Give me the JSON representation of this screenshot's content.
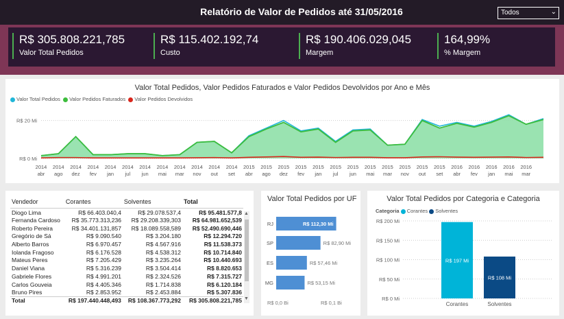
{
  "header": {
    "title": "Relatório de Valor de Pedidos até 31/05/2016",
    "filter_value": "Todos"
  },
  "kpis": [
    {
      "value": "R$ 305.808.221,785",
      "label": "Valor Total Pedidos"
    },
    {
      "value": "R$ 115.402.192,74",
      "label": "Custo"
    },
    {
      "value": "R$ 190.406.029,045",
      "label": "Margem"
    },
    {
      "value": "164,99%",
      "label": "% Margem"
    }
  ],
  "colors": {
    "header_bg": "#231b27",
    "kpi_band": "#7e3656",
    "kpi_panel": "#2b1832",
    "kpi_accent": "#4caf50",
    "total_pedidos": "#20b6d8",
    "faturados": "#3dbd3d",
    "devolvidos": "#d9261c",
    "uf_bar": "#4e8fd4",
    "corantes": "#00b4d8",
    "solventes": "#0b4a85"
  },
  "chart_data": [
    {
      "type": "area",
      "title": "Valor Total Pedidos, Valor Pedidos Faturados e Valor Pedidos Devolvidos por Ano e Mês",
      "y_ticks": [
        "R$ 20 Mi",
        "R$ 0 Mi"
      ],
      "ylim": [
        0,
        26
      ],
      "grid": true,
      "legend_position": "top-left",
      "categories": [
        {
          "year": "2014",
          "month": "abr"
        },
        {
          "year": "2014",
          "month": "ago"
        },
        {
          "year": "2014",
          "month": "dez"
        },
        {
          "year": "2014",
          "month": "fev"
        },
        {
          "year": "2014",
          "month": "jan"
        },
        {
          "year": "2014",
          "month": "jul"
        },
        {
          "year": "2014",
          "month": "jun"
        },
        {
          "year": "2014",
          "month": "mai"
        },
        {
          "year": "2014",
          "month": "mar"
        },
        {
          "year": "2014",
          "month": "nov"
        },
        {
          "year": "2014",
          "month": "out"
        },
        {
          "year": "2014",
          "month": "set"
        },
        {
          "year": "2015",
          "month": "abr"
        },
        {
          "year": "2015",
          "month": "ago"
        },
        {
          "year": "2015",
          "month": "dez"
        },
        {
          "year": "2015",
          "month": "fev"
        },
        {
          "year": "2015",
          "month": "jan"
        },
        {
          "year": "2015",
          "month": "jul"
        },
        {
          "year": "2015",
          "month": "jun"
        },
        {
          "year": "2015",
          "month": "mai"
        },
        {
          "year": "2015",
          "month": "mar"
        },
        {
          "year": "2015",
          "month": "nov"
        },
        {
          "year": "2015",
          "month": "out"
        },
        {
          "year": "2015",
          "month": "set"
        },
        {
          "year": "2016",
          "month": "abr"
        },
        {
          "year": "2016",
          "month": "fev"
        },
        {
          "year": "2016",
          "month": "jan"
        },
        {
          "year": "2016",
          "month": "mai"
        },
        {
          "year": "2016",
          "month": "mar"
        }
      ],
      "series": [
        {
          "name": "Valor Total Pedidos",
          "values": [
            1.5,
            2.5,
            11.5,
            2.0,
            2.0,
            2.5,
            2.5,
            1.5,
            2.0,
            8.5,
            9.0,
            3.0,
            12.0,
            16.0,
            20.0,
            14.5,
            16.0,
            9.0,
            15.0,
            15.5,
            7.0,
            7.5,
            20.5,
            17.0,
            19.0,
            17.0,
            19.5,
            23.0,
            18.0,
            21.0
          ]
        },
        {
          "name": "Valor Pedidos Faturados",
          "values": [
            1.5,
            2.5,
            11.5,
            2.0,
            2.0,
            2.5,
            2.5,
            1.5,
            2.0,
            8.5,
            9.0,
            3.0,
            11.5,
            15.5,
            19.0,
            14.0,
            15.5,
            8.5,
            14.5,
            15.0,
            7.0,
            7.5,
            20.0,
            16.0,
            18.5,
            16.5,
            19.0,
            22.5,
            18.0,
            20.5
          ]
        },
        {
          "name": "Valor Pedidos Devolvidos",
          "values": [
            0.3,
            0.5,
            0.5,
            0.3,
            0.3,
            0.3,
            0.3,
            0.3,
            0.3,
            0.4,
            0.5,
            0.3,
            0.6,
            0.8,
            1.0,
            0.6,
            0.7,
            0.5,
            0.6,
            0.6,
            0.4,
            0.4,
            0.8,
            0.9,
            0.7,
            0.6,
            0.7,
            0.8,
            0.5,
            0.6
          ]
        }
      ]
    },
    {
      "type": "bar",
      "orientation": "horizontal",
      "title": "Valor Total Pedidos por UF",
      "categories": [
        "RJ",
        "SP",
        "ES",
        "MG"
      ],
      "values": [
        112.3,
        82.9,
        57.46,
        53.15
      ],
      "value_labels": [
        "R$ 112,30 Mi",
        "R$ 82,90 Mi",
        "R$ 57,46 Mi",
        "R$ 53,15 Mi"
      ],
      "x_ticks": [
        "R$ 0,0 Bi",
        "R$ 0,1 Bi"
      ],
      "xlim": [
        0,
        100
      ]
    },
    {
      "type": "bar",
      "title": "Valor Total Pedidos por Categoria e Categoria",
      "legend_title": "Categoria",
      "categories": [
        "Corantes",
        "Solventes"
      ],
      "values": [
        197,
        108
      ],
      "value_labels": [
        "R$ 197 Mi",
        "R$ 108 Mi"
      ],
      "y_ticks": [
        "R$ 200 Mi",
        "R$ 150 Mi",
        "R$ 100 Mi",
        "R$ 50 Mi",
        "R$ 0 Mi"
      ],
      "ylim": [
        0,
        200
      ]
    }
  ],
  "table": {
    "headers": [
      "Vendedor",
      "Corantes",
      "Solventes",
      "Total"
    ],
    "rows": [
      [
        "Diogo Lima",
        "R$ 66.403.040,4",
        "R$ 29.078.537,4",
        "R$ 95.481.577,8"
      ],
      [
        "Fernanda Cardoso",
        "R$ 35.773.313,236",
        "R$ 29.208.339,303",
        "R$ 64.981.652,539"
      ],
      [
        "Roberto Pereira",
        "R$ 34.401.131,857",
        "R$ 18.089.558,589",
        "R$ 52.490.690,446"
      ],
      [
        "Gregório de Sá",
        "R$ 9.090.540",
        "R$ 3.204.180",
        "R$ 12.294.720"
      ],
      [
        "Alberto Barros",
        "R$ 6.970.457",
        "R$ 4.567.916",
        "R$ 11.538.373"
      ],
      [
        "Iolanda Fragoso",
        "R$ 6.176.528",
        "R$ 4.538.312",
        "R$ 10.714.840"
      ],
      [
        "Mateus Peres",
        "R$ 7.205.429",
        "R$ 3.235.264",
        "R$ 10.440.693"
      ],
      [
        "Daniel Viana",
        "R$ 5.316.239",
        "R$ 3.504.414",
        "R$ 8.820.653"
      ],
      [
        "Gabriele Flores",
        "R$ 4.991.201",
        "R$ 2.324.526",
        "R$ 7.315.727"
      ],
      [
        "Carlos Gouveia",
        "R$ 4.405.346",
        "R$ 1.714.838",
        "R$ 6.120.184"
      ],
      [
        "Bruno Pires",
        "R$ 2.853.952",
        "R$ 2.453.884",
        "R$ 5.307.836"
      ]
    ],
    "total_row": [
      "Total",
      "R$ 197.440.448,493",
      "R$ 108.367.773,292",
      "R$ 305.808.221,785"
    ]
  }
}
